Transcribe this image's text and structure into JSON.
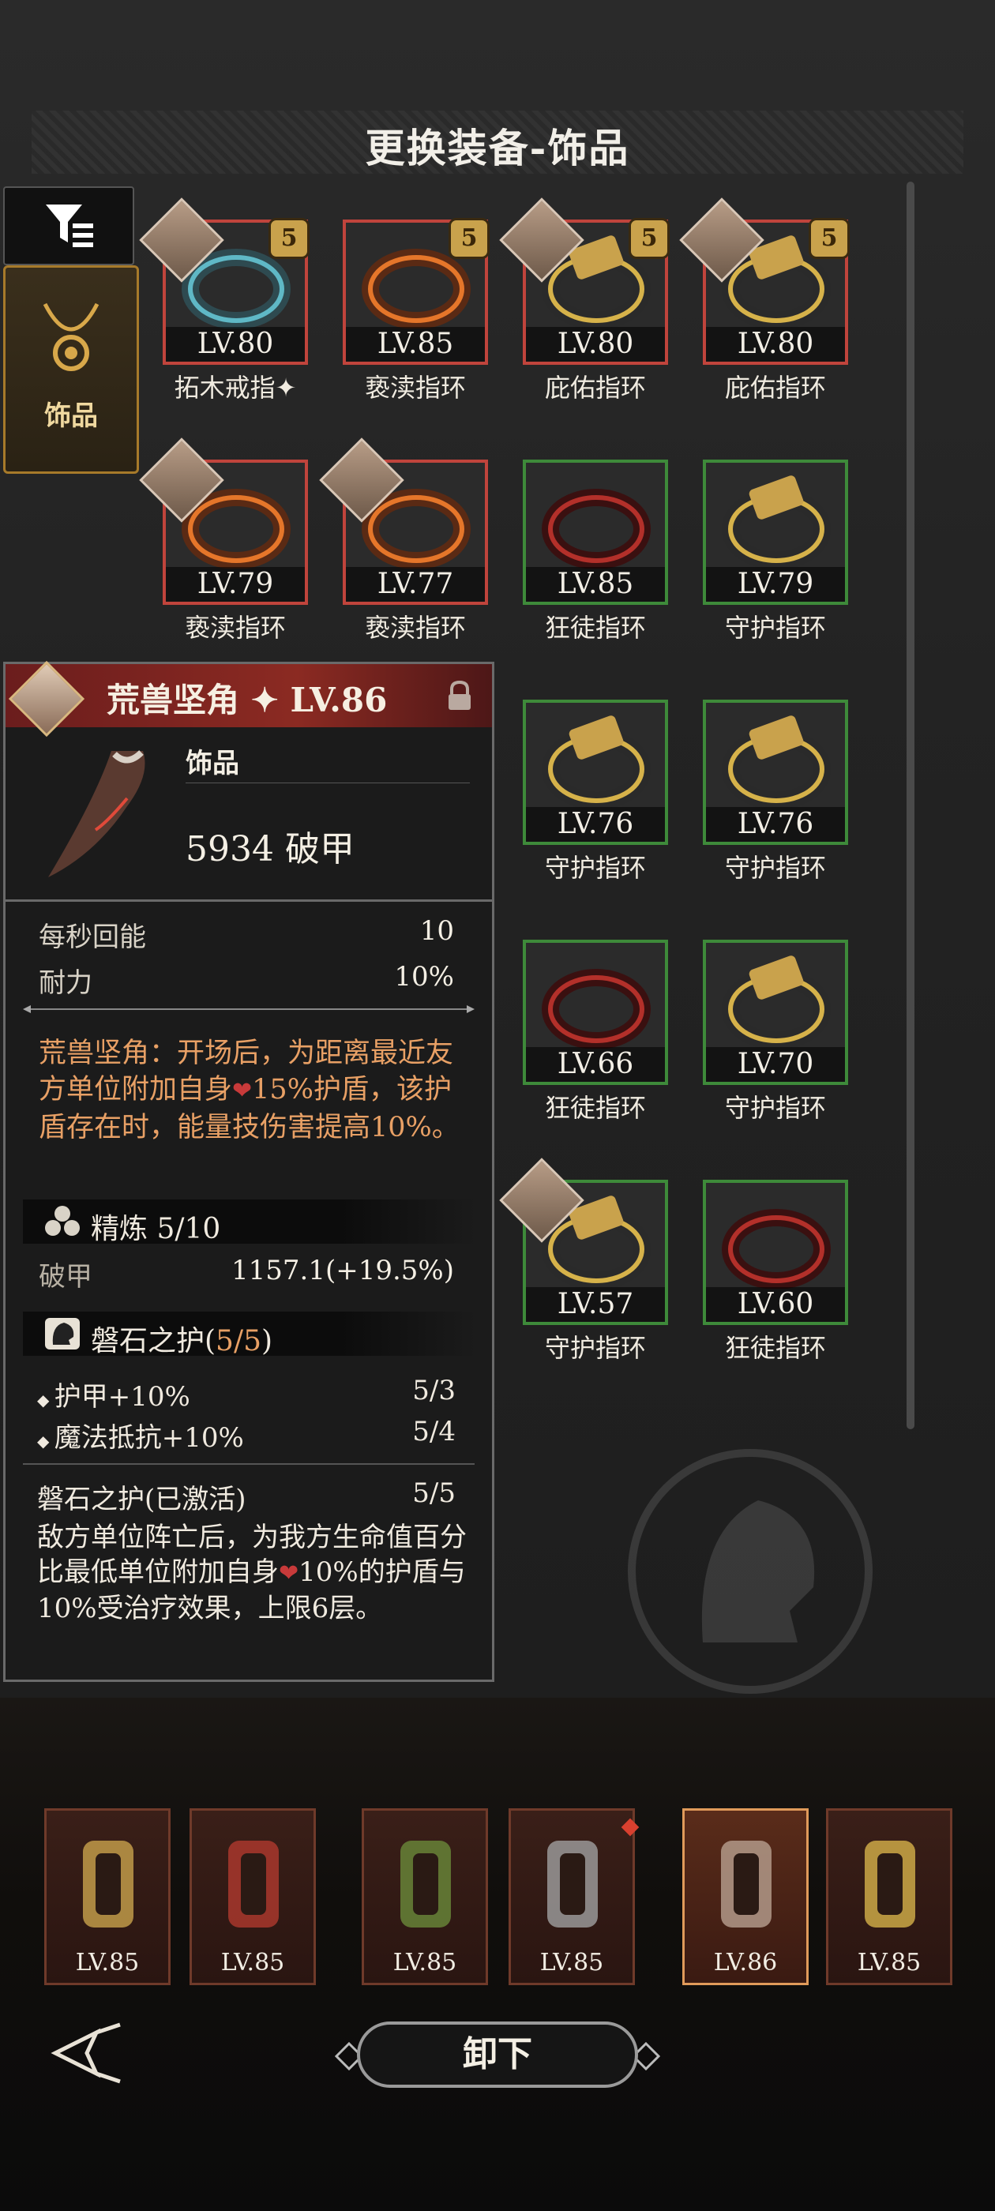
{
  "header": {
    "title": "更换装备-饰品"
  },
  "sidebar": {
    "tab_label": "饰品"
  },
  "grid": [
    {
      "level": "LV.80",
      "name": "拓木戒指",
      "star": true,
      "badge": "5",
      "avatar": true,
      "border": "red",
      "style": "teal"
    },
    {
      "level": "LV.85",
      "name": "亵渎指环",
      "star": false,
      "badge": "5",
      "avatar": false,
      "border": "red",
      "style": "flame"
    },
    {
      "level": "LV.80",
      "name": "庇佑指环",
      "star": false,
      "badge": "5",
      "avatar": true,
      "border": "red",
      "style": "gold"
    },
    {
      "level": "LV.80",
      "name": "庇佑指环",
      "star": false,
      "badge": "5",
      "avatar": true,
      "border": "red",
      "style": "gold"
    },
    {
      "level": "LV.79",
      "name": "亵渎指环",
      "star": false,
      "badge": "",
      "avatar": true,
      "border": "red",
      "style": "flame"
    },
    {
      "level": "LV.77",
      "name": "亵渎指环",
      "star": false,
      "badge": "",
      "avatar": true,
      "border": "red",
      "style": "flame"
    },
    {
      "level": "LV.85",
      "name": "狂徒指环",
      "star": false,
      "badge": "",
      "avatar": false,
      "border": "green",
      "style": "dark"
    },
    {
      "level": "LV.79",
      "name": "守护指环",
      "star": false,
      "badge": "",
      "avatar": false,
      "border": "green",
      "style": "gold"
    },
    {
      "level": "LV.76",
      "name": "守护指环",
      "star": false,
      "badge": "",
      "avatar": false,
      "border": "green",
      "style": "gold"
    },
    {
      "level": "LV.76",
      "name": "守护指环",
      "star": false,
      "badge": "",
      "avatar": false,
      "border": "green",
      "style": "gold"
    },
    {
      "level": "LV.66",
      "name": "狂徒指环",
      "star": false,
      "badge": "",
      "avatar": false,
      "border": "green",
      "style": "dark"
    },
    {
      "level": "LV.70",
      "name": "守护指环",
      "star": false,
      "badge": "",
      "avatar": false,
      "border": "green",
      "style": "gold"
    },
    {
      "level": "LV.57",
      "name": "守护指环",
      "star": false,
      "badge": "",
      "avatar": true,
      "border": "green",
      "style": "gold"
    },
    {
      "level": "LV.60",
      "name": "狂徒指环",
      "star": false,
      "badge": "",
      "avatar": false,
      "border": "green",
      "style": "dark"
    }
  ],
  "detail": {
    "name": "荒兽坚角",
    "level": "LV.86",
    "type": "饰品",
    "main_stat": "5934 破甲",
    "stats": [
      {
        "label": "每秒回能",
        "value": "10"
      },
      {
        "label": "耐力",
        "value": "10%"
      }
    ],
    "skill_pre": "荒兽坚角：开场后，为距离最近友方单位附加自身",
    "skill_post": "15%护盾，该护盾存在时，能量技伤害提高10%。",
    "refine": {
      "label": "精炼 5/10",
      "stat_label": "破甲",
      "stat_value": "1157.1(+19.5%)"
    },
    "set": {
      "name": "磐石之护(",
      "count": "5/5",
      "close": ")",
      "bonuses": [
        {
          "label": "护甲+10%",
          "value": "5/3"
        },
        {
          "label": "魔法抵抗+10%",
          "value": "5/4"
        }
      ],
      "active_label": "磐石之护(已激活)",
      "active_value": "5/5",
      "desc_pre": "敌方单位阵亡后，为我方生命值百分比最低单位附加自身",
      "desc_post": "10%的护盾与10%受治疗效果，上限6层。"
    }
  },
  "equipped": [
    {
      "level": "LV.85"
    },
    {
      "level": "LV.85"
    },
    {
      "level": "LV.85"
    },
    {
      "level": "LV.85"
    },
    {
      "level": "LV.86"
    },
    {
      "level": "LV.85"
    }
  ],
  "actions": {
    "unequip": "卸下"
  }
}
